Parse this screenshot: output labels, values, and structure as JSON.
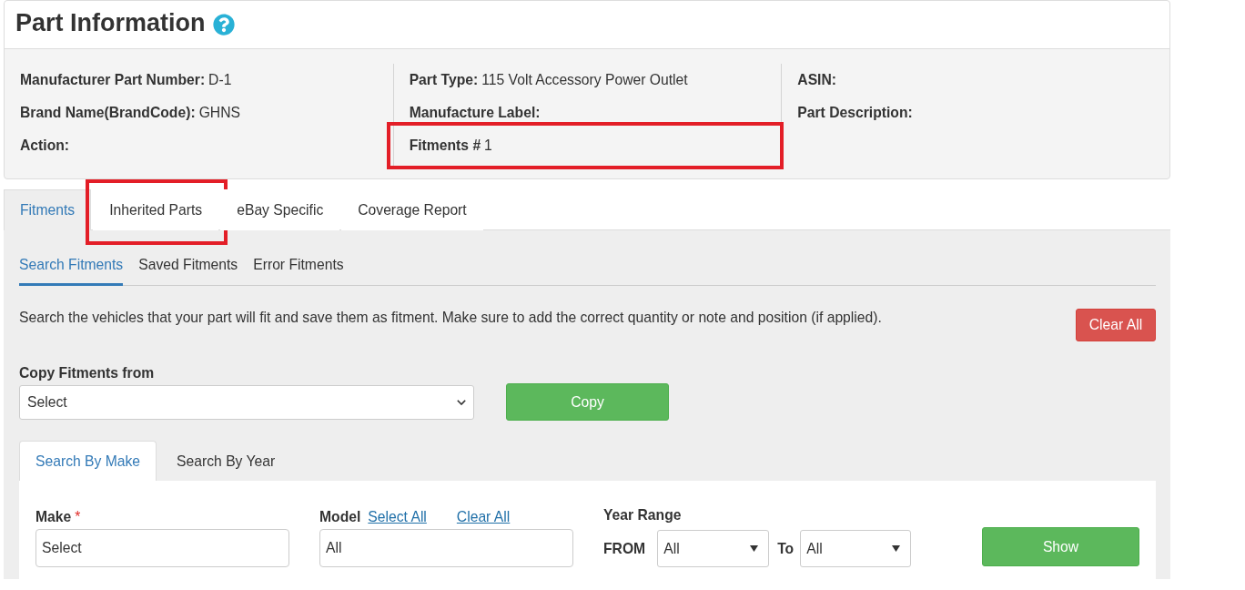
{
  "header": {
    "title": "Part Information"
  },
  "info_columns": [
    {
      "items": [
        {
          "label": "Manufacturer Part Number:",
          "value": "D-1",
          "highlighted": false
        },
        {
          "label": "Brand Name(BrandCode):",
          "value": "GHNS",
          "highlighted": false
        },
        {
          "label": "Action:",
          "highlighted": false
        }
      ]
    },
    {
      "items": [
        {
          "label": "Part Type:",
          "value": "115 Volt Accessory Power Outlet",
          "highlighted": false
        },
        {
          "label": "Manufacture Label:",
          "highlighted": false
        },
        {
          "label": "Fitments #",
          "value": "1",
          "highlighted": true
        }
      ]
    },
    {
      "items": [
        {
          "label": "ASIN:",
          "highlighted": false
        },
        {
          "label": "Part Description:",
          "highlighted": false
        }
      ]
    }
  ],
  "tabs": [
    {
      "label": "Fitments",
      "selected": true,
      "highlighted": false
    },
    {
      "label": "Inherited Parts",
      "selected": false,
      "highlighted": true
    },
    {
      "label": "eBay Specific",
      "selected": false,
      "highlighted": false
    },
    {
      "label": "Coverage Report",
      "selected": false,
      "highlighted": false
    }
  ],
  "subtabs": [
    {
      "label": "Search Fitments",
      "selected": true
    },
    {
      "label": "Saved Fitments",
      "selected": false
    },
    {
      "label": "Error Fitments",
      "selected": false
    }
  ],
  "intro": "Search the vehicles that your part will fit and save them as fitment. Make sure to add the correct quantity or note and position (if applied).",
  "clear_all_button": "Clear All",
  "copy_fitments": {
    "label": "Copy Fitments from",
    "select_value": "Select",
    "button": "Copy"
  },
  "search_tabs": [
    {
      "label": "Search By Make",
      "selected": true
    },
    {
      "label": "Search By Year",
      "selected": false
    }
  ],
  "search_form": {
    "make": {
      "label": "Make",
      "required_mark": "*",
      "value": "Select"
    },
    "model": {
      "label": "Model",
      "links": [
        "Select All",
        "Clear All"
      ],
      "value": "All"
    },
    "year_range": {
      "label": "Year Range",
      "from": {
        "label": "FROM",
        "value": "All"
      },
      "to": {
        "label": "To",
        "value": "All"
      }
    },
    "show_button": "Show"
  }
}
